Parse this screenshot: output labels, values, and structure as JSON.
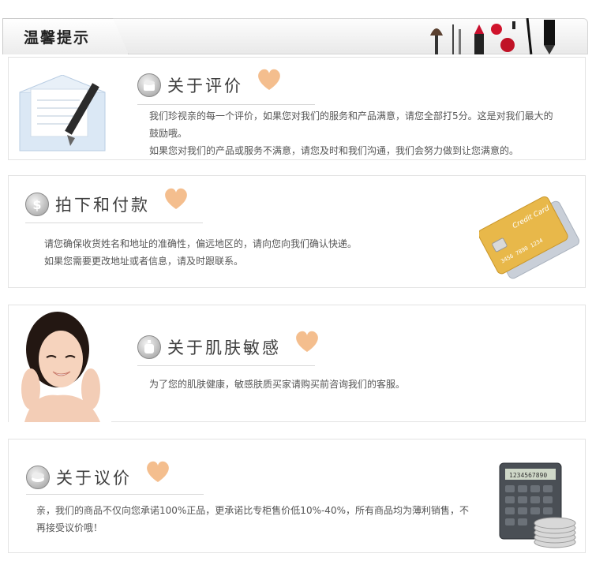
{
  "header": {
    "title": "温馨提示"
  },
  "sections": [
    {
      "heading": "关于评价",
      "lines": [
        "我们珍视亲的每一个评价，如果您对我们的服务和产品满意，请您全部打5分。这是对我们最大的",
        "鼓励哦。",
        "如果您对我们的产品或服务不满意，请您及时和我们沟通，我们会努力做到让您满意的。"
      ]
    },
    {
      "heading": "拍下和付款",
      "lines": [
        "请您确保收货姓名和地址的准确性，偏远地区的，请向您向我们确认快递。",
        "如果您需要更改地址或者信息，请及时跟联系。"
      ],
      "card_text": "Credit Card"
    },
    {
      "heading": "关于肌肤敏感",
      "lines": [
        "为了您的肌肤健康，敏感肤质买家请购买前咨询我们的客服。"
      ]
    },
    {
      "heading": "关于议价",
      "lines": [
        "亲，我们的商品不仅向您承诺100%正品，更承诺比专柜售价低10%-40%，所有商品均为薄利销售，不",
        "再接受议价哦！"
      ],
      "calculator_display": "1234567890"
    }
  ],
  "icons": {
    "header_art": "cosmetics-icon",
    "s1_art": "envelope-pen-icon",
    "s1_badge": "cream-jar-icon",
    "s2_badge": "dollar-icon",
    "s2_art": "credit-card-icon",
    "s3_art": "smiling-woman-photo",
    "s3_badge": "perfume-bottle-icon",
    "s4_badge": "makeup-compact-icon",
    "s4_art": "calculator-coins-icon",
    "heart": "heart-icon"
  },
  "colors": {
    "heart": "#f0b27a",
    "card_gold": "#e8b84a",
    "card_silver": "#c9cfd8"
  }
}
